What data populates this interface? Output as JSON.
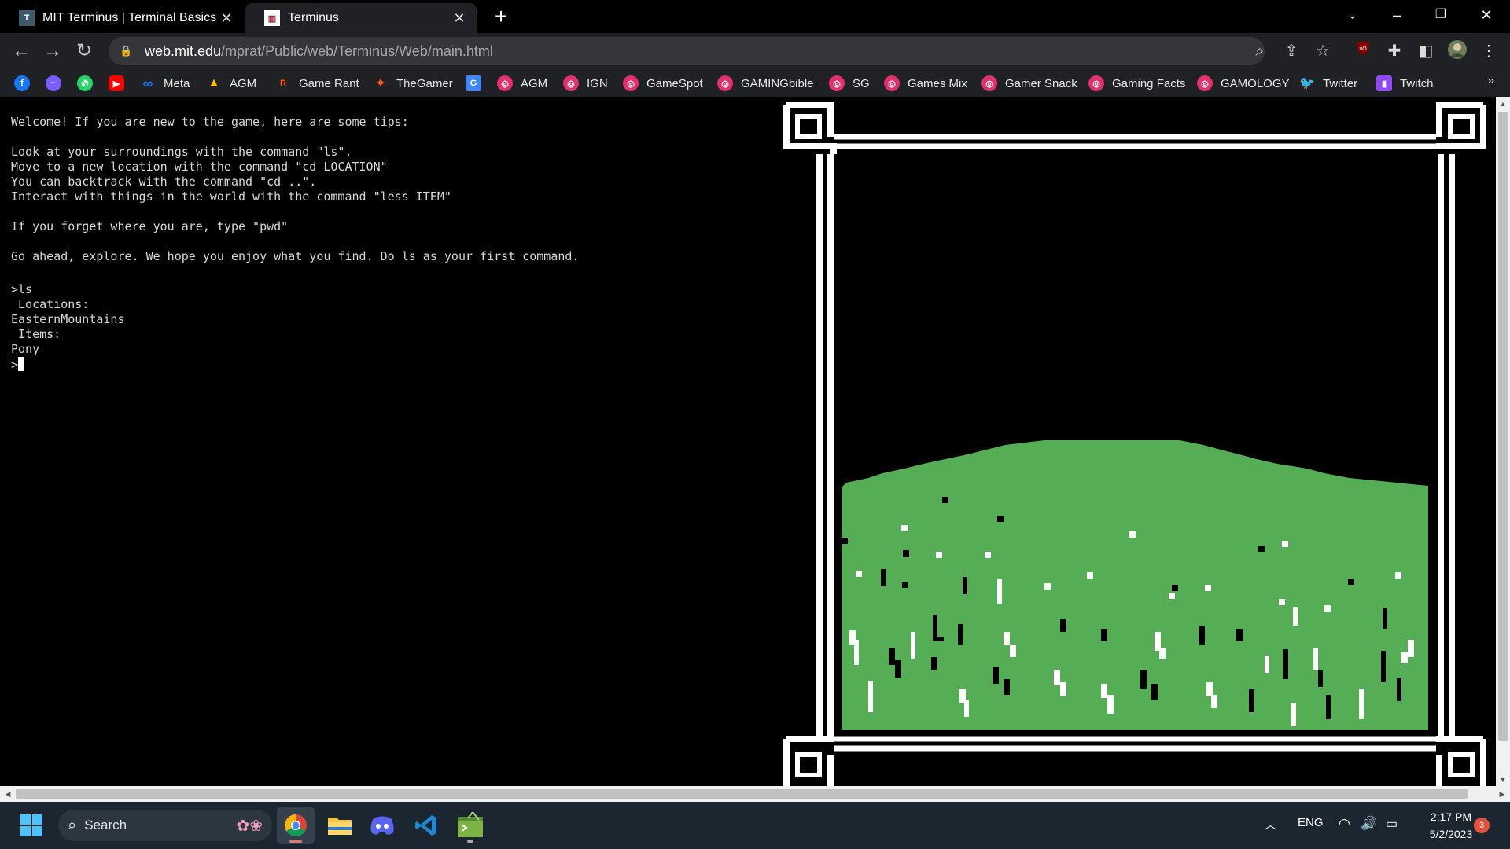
{
  "browser": {
    "tabs": [
      {
        "title": "MIT Terminus | Terminal Basics",
        "active": false
      },
      {
        "title": "Terminus",
        "active": true
      }
    ],
    "new_tab_label": "+",
    "url_host": "web.mit.edu",
    "url_path": "/mprat/Public/web/Terminus/Web/main.html"
  },
  "bookmarks": {
    "items": [
      {
        "label": "",
        "icon": "facebook-icon",
        "color": "#1877f2"
      },
      {
        "label": "",
        "icon": "messenger-icon",
        "color": "#7b5cff"
      },
      {
        "label": "",
        "icon": "whatsapp-icon",
        "color": "#25d366"
      },
      {
        "label": "",
        "icon": "youtube-icon",
        "color": "#ff0000"
      },
      {
        "label": "Meta",
        "icon": "meta-icon",
        "color": "#0a7cff"
      },
      {
        "label": "AGM",
        "icon": "drive-icon",
        "color": "#34a853"
      },
      {
        "label": "Game Rant",
        "icon": "gamerant-icon",
        "color": "#ff4f00"
      },
      {
        "label": "TheGamer",
        "icon": "thegamer-icon",
        "color": "#e65c2f"
      },
      {
        "label": "",
        "icon": "translate-icon",
        "color": "#4285f4"
      },
      {
        "label": "AGM",
        "icon": "instagram-icon",
        "color": "#e1306c"
      },
      {
        "label": "IGN",
        "icon": "instagram-icon",
        "color": "#e1306c"
      },
      {
        "label": "GameSpot",
        "icon": "instagram-icon",
        "color": "#e1306c"
      },
      {
        "label": "GAMINGbible",
        "icon": "instagram-icon",
        "color": "#e1306c"
      },
      {
        "label": "SG",
        "icon": "instagram-icon",
        "color": "#e1306c"
      },
      {
        "label": "Games Mix",
        "icon": "instagram-icon",
        "color": "#e1306c"
      },
      {
        "label": "Gamer Snack",
        "icon": "instagram-icon",
        "color": "#e1306c"
      },
      {
        "label": "Gaming Facts",
        "icon": "instagram-icon",
        "color": "#e1306c"
      },
      {
        "label": "GAMOLOGY",
        "icon": "instagram-icon",
        "color": "#e1306c"
      },
      {
        "label": "Twitter",
        "icon": "twitter-icon",
        "color": "#1d9bf0"
      },
      {
        "label": "Twitch",
        "icon": "twitch-icon",
        "color": "#9146ff"
      }
    ],
    "more_label": "»"
  },
  "terminal": {
    "welcome": "Welcome! If you are new to the game, here are some tips:",
    "tip_ls": "Look at your surroundings with the command \"ls\".",
    "tip_cd": "Move to a new location with the command \"cd LOCATION\"",
    "tip_back": "You can backtrack with the command \"cd ..\".",
    "tip_less": "Interact with things in the world with the command \"less ITEM\"",
    "tip_pwd": "If you forget where you are, type \"pwd\"",
    "explore": "Go ahead, explore. We hope you enjoy what you find. Do ls as your first command.",
    "command": ">ls",
    "locations_header": " Locations:",
    "location": "EasternMountains",
    "items_header": " Items:",
    "item": "Pony",
    "prompt": ">"
  },
  "scene": {
    "frame_color": "#ffffff",
    "grass_color": "#55ad56"
  },
  "taskbar": {
    "search_label": "Search",
    "language": "ENG",
    "time": "2:17 PM",
    "date": "5/2/2023",
    "notification_count": "3"
  }
}
